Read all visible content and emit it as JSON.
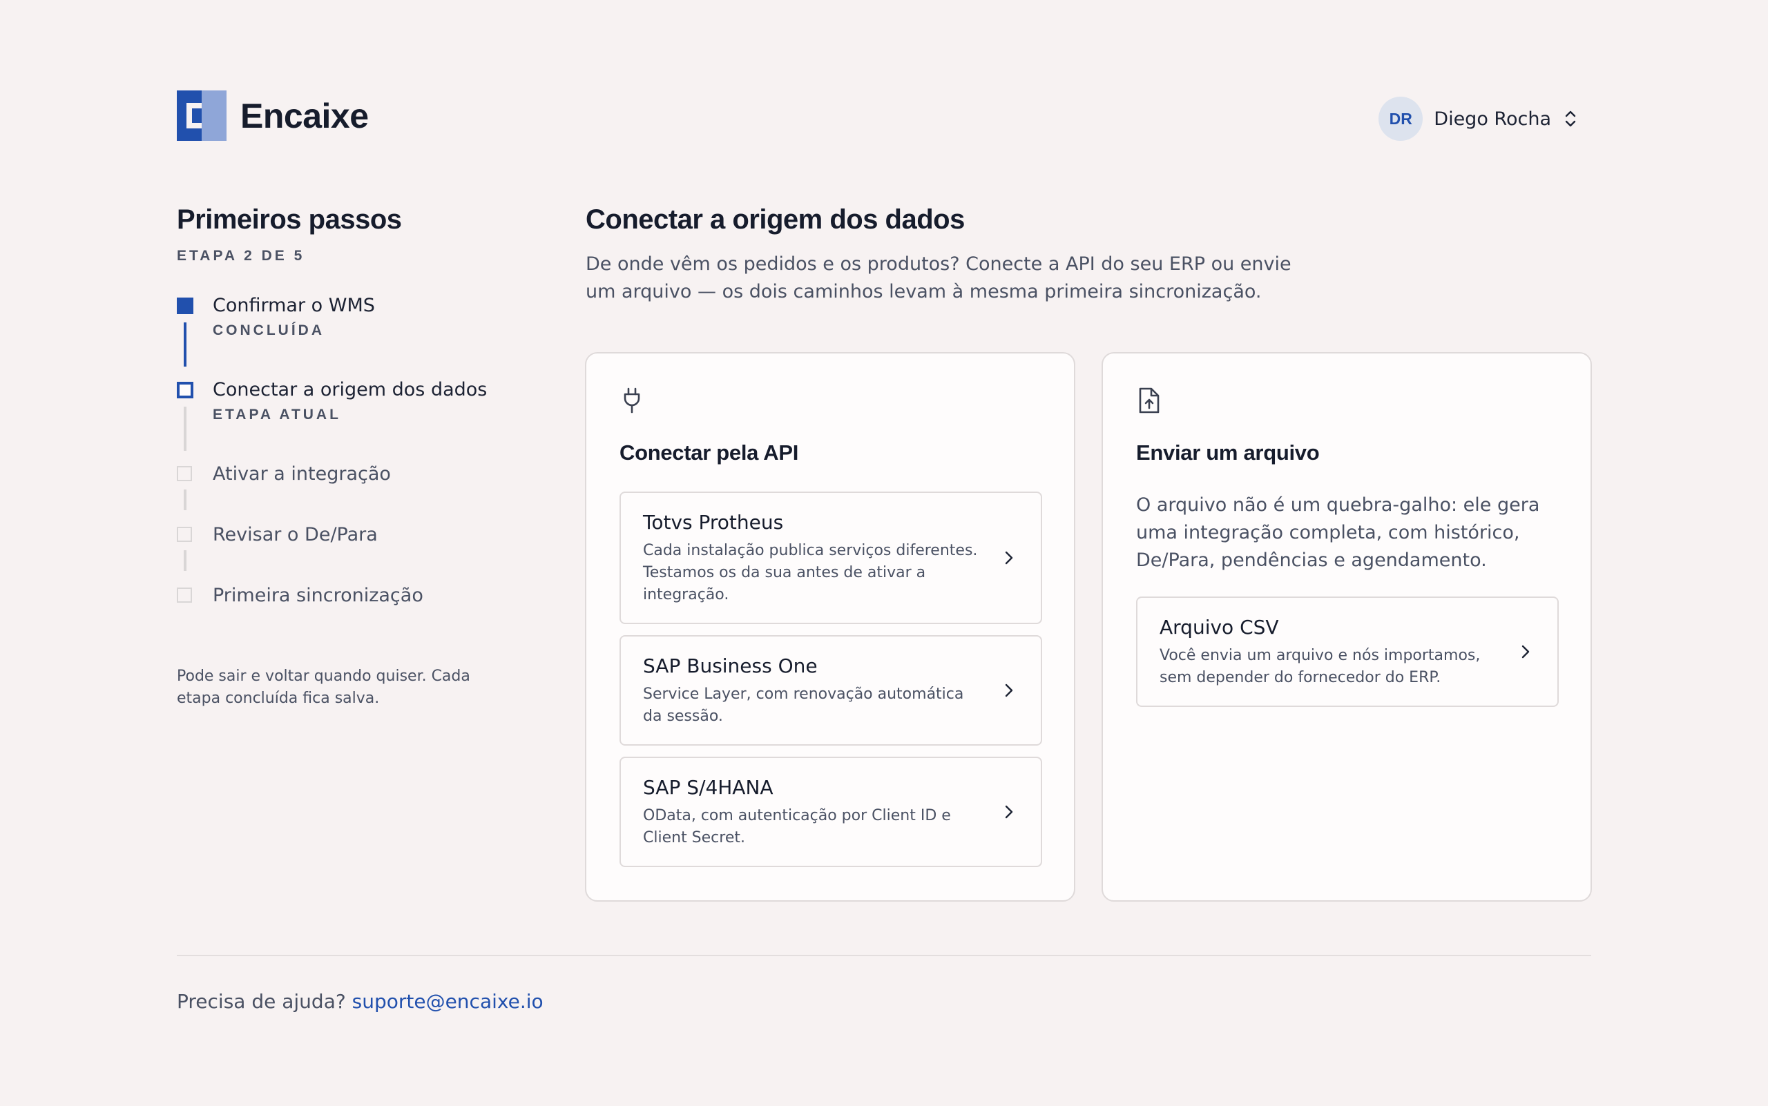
{
  "app": {
    "name": "Encaixe"
  },
  "user": {
    "initials": "DR",
    "name": "Diego Rocha"
  },
  "sidebar": {
    "title": "Primeiros passos",
    "step_counter": "ETAPA 2 DE 5",
    "steps": [
      {
        "label": "Confirmar o WMS",
        "status": "CONCLUÍDA",
        "state": "done"
      },
      {
        "label": "Conectar a origem dos dados",
        "status": "ETAPA ATUAL",
        "state": "current"
      },
      {
        "label": "Ativar a integração",
        "state": "pending"
      },
      {
        "label": "Revisar o De/Para",
        "state": "pending"
      },
      {
        "label": "Primeira sincronização",
        "state": "pending"
      }
    ],
    "note": "Pode sair e voltar quando quiser. Cada etapa concluída fica salva."
  },
  "main": {
    "title": "Conectar a origem dos dados",
    "description": "De onde vêm os pedidos e os produtos? Conecte a API do seu ERP ou envie um arquivo — os dois caminhos levam à mesma primeira sincronização."
  },
  "api_card": {
    "icon": "plug-icon",
    "title": "Conectar pela API",
    "options": [
      {
        "title": "Totvs Protheus",
        "description": "Cada instalação publica serviços diferentes. Testamos os da sua antes de ativar a integração."
      },
      {
        "title": "SAP Business One",
        "description": "Service Layer, com renovação automática da sessão."
      },
      {
        "title": "SAP S/4HANA",
        "description": "OData, com autenticação por Client ID e Client Secret."
      }
    ]
  },
  "file_card": {
    "icon": "file-upload-icon",
    "title": "Enviar um arquivo",
    "description": "O arquivo não é um quebra-galho: ele gera uma integração completa, com histórico, De/Para, pendências e agendamento.",
    "options": [
      {
        "title": "Arquivo CSV",
        "description": "Você envia um arquivo e nós importamos, sem depender do fornecedor do ERP."
      }
    ]
  },
  "footer": {
    "help_text": "Precisa de ajuda?",
    "support_email": "suporte@encaixe.io"
  },
  "colors": {
    "accent": "#2150ad",
    "background": "#f7f2f2",
    "card": "#fefcfc"
  }
}
